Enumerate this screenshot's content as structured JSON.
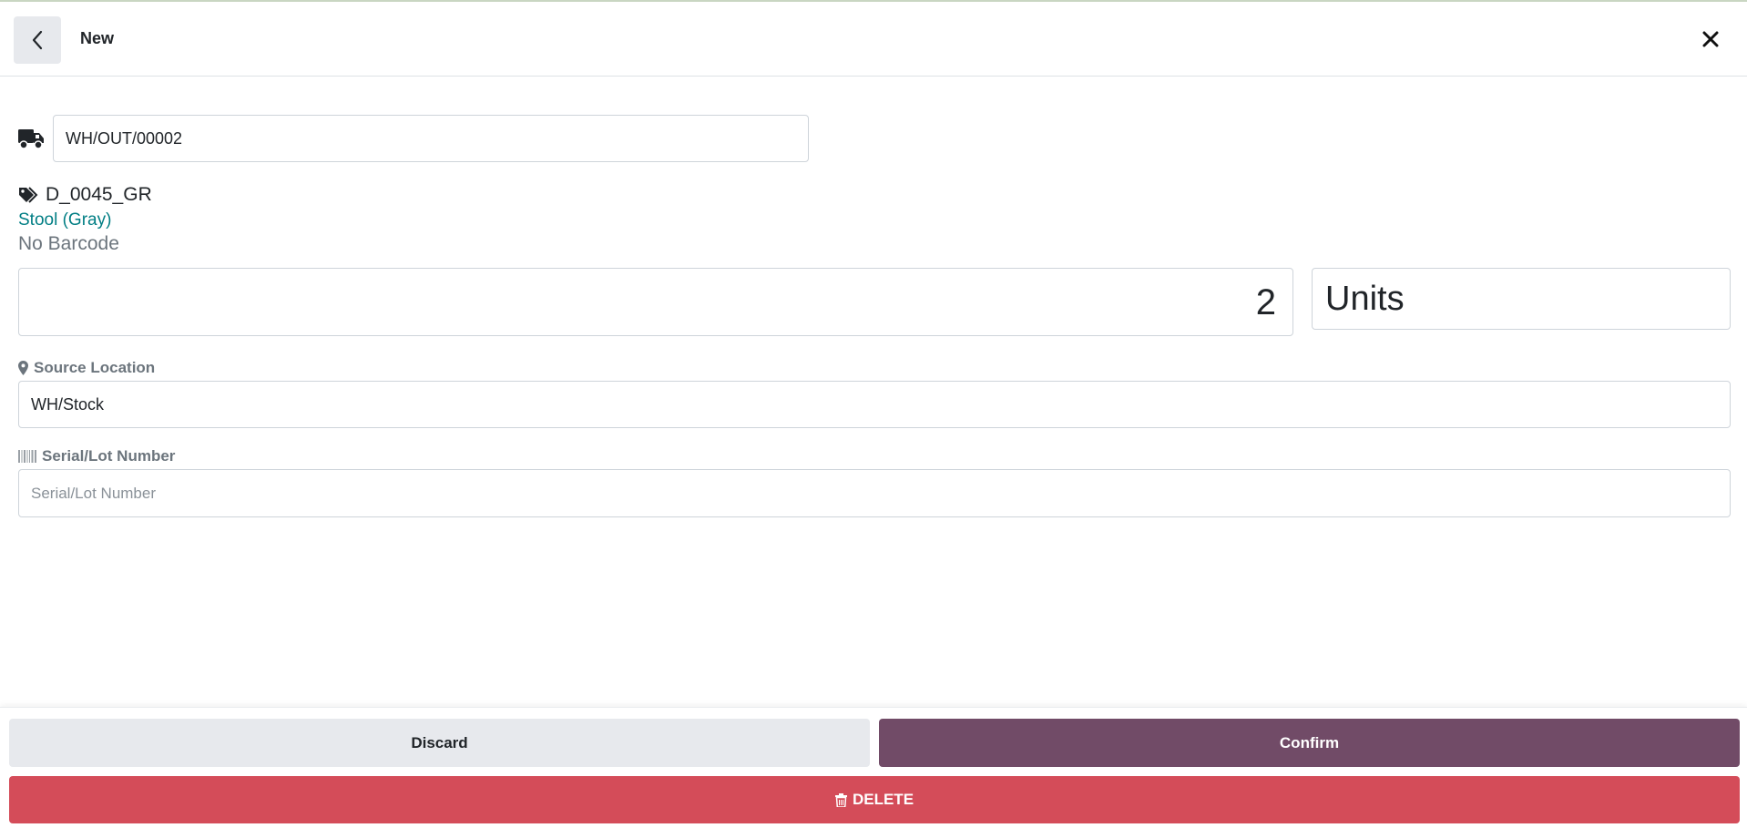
{
  "header": {
    "title": "New",
    "back_icon": "chevron-left-icon",
    "close_icon": "close-icon"
  },
  "picking": {
    "icon": "truck-icon",
    "value": "WH/OUT/00002"
  },
  "product": {
    "icon": "tags-icon",
    "code": "D_0045_GR",
    "name": "Stool (Gray)",
    "barcode": "No Barcode"
  },
  "quantity": {
    "value": "2",
    "uom": "Units"
  },
  "source_location": {
    "label": "Source Location",
    "icon": "map-marker-icon",
    "value": "WH/Stock"
  },
  "lot": {
    "label": "Serial/Lot Number",
    "icon": "barcode-icon",
    "placeholder": "Serial/Lot Number",
    "value": ""
  },
  "footer": {
    "discard_label": "Discard",
    "confirm_label": "Confirm",
    "delete_label": "DELETE",
    "delete_icon": "trash-icon"
  },
  "colors": {
    "primary": "#714b67",
    "danger": "#d44c59",
    "secondary": "#e7e9ed",
    "link": "#017e84"
  }
}
